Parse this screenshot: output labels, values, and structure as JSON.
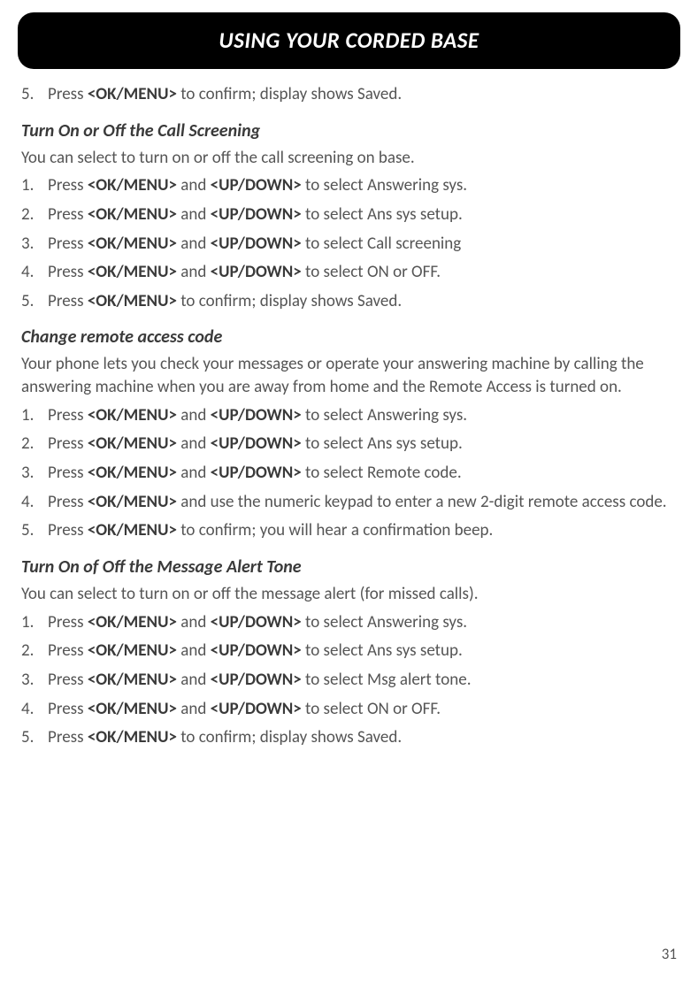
{
  "key_okmenu": "<OK/MENU>",
  "key_updown": "<UP/DOWN>",
  "header": {
    "title": "USING YOUR CORDED BASE"
  },
  "continued": {
    "num": "5.",
    "pre": "Press ",
    "post": " to confirm; display shows Saved."
  },
  "sections": [
    {
      "heading": "Turn On or Off the Call Screening",
      "intro": "You can select to turn on or off the call screening on base.",
      "steps": [
        {
          "pre": "Press ",
          "mid": " and ",
          "post": " to select Answering sys.",
          "two_keys": true
        },
        {
          "pre": "Press ",
          "mid": " and ",
          "post": " to select Ans sys setup.",
          "two_keys": true
        },
        {
          "pre": "Press ",
          "mid": " and ",
          "post": " to select Call screening",
          "two_keys": true
        },
        {
          "pre": "Press ",
          "mid": " and ",
          "post": " to select ON or OFF.",
          "two_keys": true
        },
        {
          "pre": "Press ",
          "post": " to confirm; display shows Saved.",
          "two_keys": false
        }
      ]
    },
    {
      "heading": "Change remote access code",
      "intro": "Your phone lets you check your messages or operate your answering machine by calling the answering machine when you are away from home and the Remote Access is turned on.",
      "steps": [
        {
          "pre": "Press ",
          "mid": " and ",
          "post": " to select Answering sys.",
          "two_keys": true
        },
        {
          "pre": "Press ",
          "mid": " and ",
          "post": " to select Ans sys setup.",
          "two_keys": true
        },
        {
          "pre": "Press ",
          "mid": " and ",
          "post": " to select Remote code.",
          "two_keys": true
        },
        {
          "pre": "Press ",
          "post": " and use the numeric keypad to enter a new 2-digit remote access code.",
          "two_keys": false
        },
        {
          "pre": "Press ",
          "post": " to confirm; you will hear a confirmation beep.",
          "two_keys": false
        }
      ]
    },
    {
      "heading": "Turn On of Off the Message Alert Tone",
      "intro": "You can select to turn on or off the message alert (for missed calls).",
      "steps": [
        {
          "pre": "Press ",
          "mid": " and ",
          "post": " to select Answering sys.",
          "two_keys": true
        },
        {
          "pre": "Press ",
          "mid": " and ",
          "post": " to select Ans sys setup.",
          "two_keys": true
        },
        {
          "pre": "Press ",
          "mid": " and ",
          "post": " to select Msg alert tone.",
          "two_keys": true
        },
        {
          "pre": "Press ",
          "mid": " and ",
          "post": " to select ON or OFF.",
          "two_keys": true
        },
        {
          "pre": "Press ",
          "post": " to confirm; display shows Saved.",
          "two_keys": false
        }
      ]
    }
  ],
  "page_number": "31"
}
